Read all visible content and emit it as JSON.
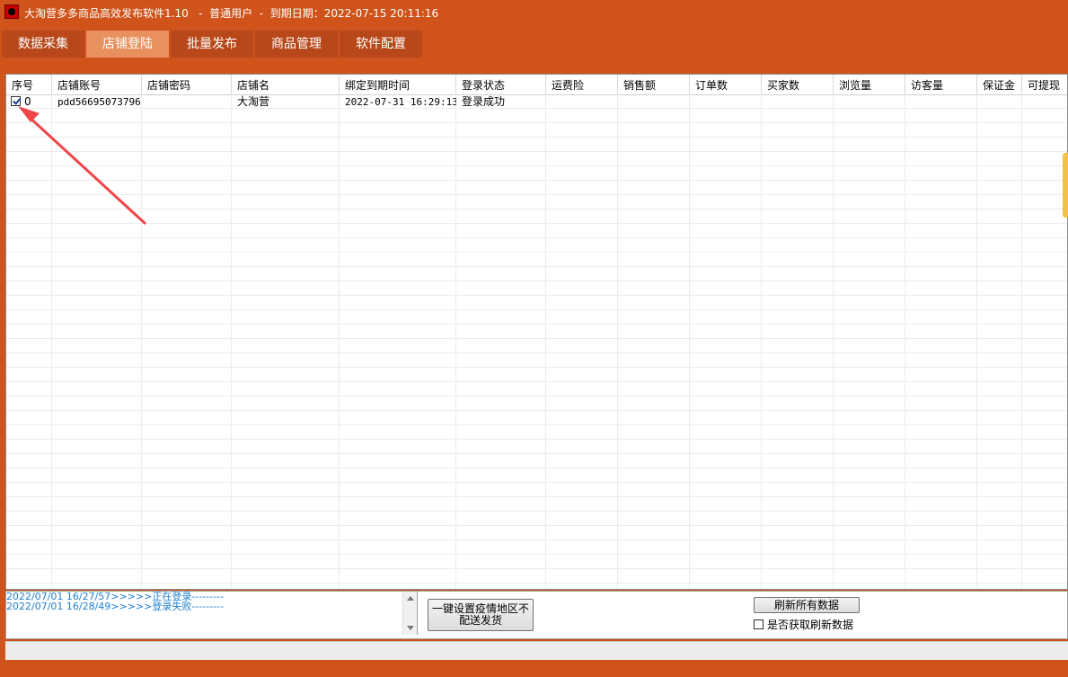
{
  "window": {
    "title": "大淘营多多商品高效发布软件1.10   -  普通用户  -  到期日期：2022-07-15 20:11:16"
  },
  "tabs": [
    {
      "label": "数据采集",
      "active": false
    },
    {
      "label": "店铺登陆",
      "active": true
    },
    {
      "label": "批量发布",
      "active": false
    },
    {
      "label": "商品管理",
      "active": false
    },
    {
      "label": "软件配置",
      "active": false
    }
  ],
  "table": {
    "columns": [
      "序号",
      "店铺账号",
      "店铺密码",
      "店铺名",
      "绑定到期时间",
      "登录状态",
      "运费险",
      "销售额",
      "订单数",
      "买家数",
      "浏览量",
      "访客量",
      "保证金",
      "可提现"
    ],
    "rows": [
      {
        "checked": true,
        "index": "0",
        "account": "pdd56695073796",
        "password": "",
        "shop_name": "大淘营",
        "expire": "2022-07-31 16:29:13",
        "status": "登录成功",
        "freight_ins": "",
        "sales": "",
        "orders": "",
        "buyers": "",
        "views": "",
        "visitors": "",
        "deposit": "",
        "withdrawable": ""
      }
    ]
  },
  "log": {
    "lines": [
      "2022/07/01 16/27/57>>>>>正在登录---------",
      "2022/07/01 16/28/49>>>>>登录失败---------"
    ]
  },
  "buttons": {
    "covid_line1": "一键设置疫情地区不",
    "covid_line2": "配送发货",
    "refresh_all": "刷新所有数据"
  },
  "refresh_option": {
    "label": "是否获取刷新数据",
    "checked": false
  },
  "colors": {
    "background": "#cf531b",
    "tab_active": "#e8915e",
    "log_text": "#1e7fd0",
    "arrow": "#f0464a"
  }
}
